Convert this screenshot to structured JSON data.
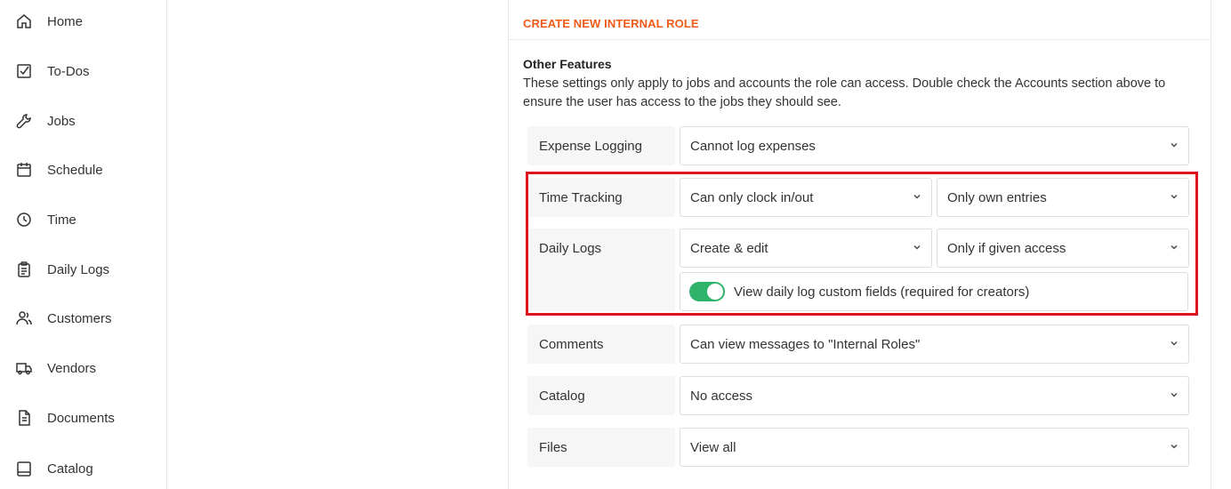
{
  "sidebar": {
    "items": [
      {
        "label": "Home",
        "icon": "home-icon"
      },
      {
        "label": "To-Dos",
        "icon": "checkbox-icon"
      },
      {
        "label": "Jobs",
        "icon": "wrench-icon"
      },
      {
        "label": "Schedule",
        "icon": "calendar-icon"
      },
      {
        "label": "Time",
        "icon": "clock-icon"
      },
      {
        "label": "Daily Logs",
        "icon": "clipboard-icon"
      },
      {
        "label": "Customers",
        "icon": "users-icon"
      },
      {
        "label": "Vendors",
        "icon": "truck-icon"
      },
      {
        "label": "Documents",
        "icon": "document-icon"
      },
      {
        "label": "Catalog",
        "icon": "book-icon"
      }
    ]
  },
  "panel": {
    "title": "CREATE NEW INTERNAL ROLE",
    "section_title": "Other Features",
    "section_desc": "These settings only apply to jobs and accounts the role can access. Double check the Accounts section above to ensure the user has access to the jobs they should see."
  },
  "rows": {
    "expense": {
      "label": "Expense Logging",
      "value": "Cannot log expenses"
    },
    "time": {
      "label": "Time Tracking",
      "value": "Can only clock in/out",
      "value2": "Only own entries"
    },
    "daily": {
      "label": "Daily Logs",
      "value": "Create & edit",
      "value2": "Only if given access",
      "toggle_label": "View daily log custom fields (required for creators)",
      "toggle_on": true
    },
    "comments": {
      "label": "Comments",
      "value": "Can view messages to \"Internal Roles\""
    },
    "catalog": {
      "label": "Catalog",
      "value": "No access"
    },
    "files": {
      "label": "Files",
      "value": "View all"
    }
  },
  "colors": {
    "accent": "#f05a18",
    "toggle": "#2fb36a",
    "highlight": "#e0141e"
  }
}
